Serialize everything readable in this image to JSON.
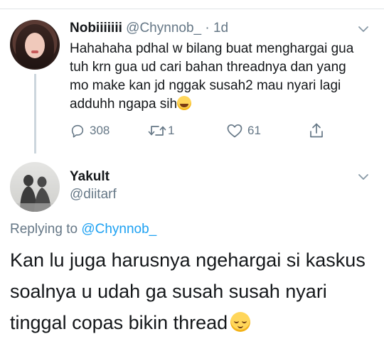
{
  "tweet_1": {
    "display_name": "Nobiiiiiii",
    "handle": "@Chynnob_",
    "separator": "·",
    "time": "1d",
    "text": "Hahahaha pdhal w bilang buat menghargai gua tuh krn gua ud cari bahan threadnya dan yang mo make kan jd nggak susah2 mau nyari lagi adduhh ngapa sih",
    "emoji": "grinning-face-with-sweat",
    "avatar_icon": "profile-photo",
    "actions": {
      "reply_count": "308",
      "retweet_count": "1",
      "like_count": "61",
      "share_icon": "share-icon"
    }
  },
  "tweet_2": {
    "display_name": "Yakult",
    "handle": "@diitarf",
    "replying_prefix": "Replying to",
    "replying_mention": "@Chynnob_",
    "text": "Kan lu juga harusnya ngehargai si kaskus soalnya u udah ga susah susah nyari tinggal copas bikin thread",
    "emoji": "relieved-face",
    "avatar_icon": "profile-photo"
  },
  "colors": {
    "primary_text": "#14171a",
    "secondary_text": "#657786",
    "link": "#1da1f2",
    "divider": "#dfe3e6",
    "thread_line": "#ccd6dd"
  }
}
